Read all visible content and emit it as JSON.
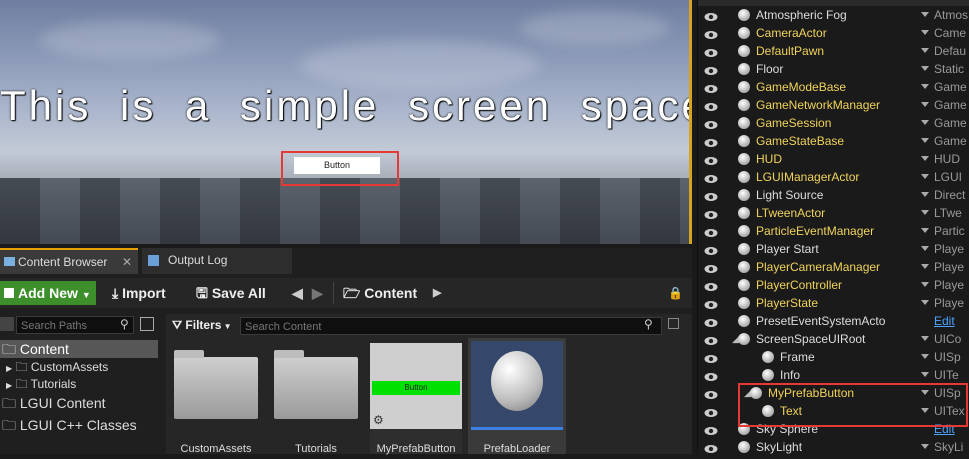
{
  "viewport": {
    "ui_text": "This is a simple screen space UI.",
    "button_label": "Button"
  },
  "tabs": [
    {
      "label": "Content Browser"
    },
    {
      "label": "Output Log"
    }
  ],
  "toolbar": {
    "add_new": "Add New",
    "import": "Import",
    "save_all": "Save All",
    "path": "Content"
  },
  "search": {
    "paths_placeholder": "Search Paths",
    "filters": "Filters",
    "content_placeholder": "Search Content"
  },
  "tree": [
    "Content",
    "CustomAssets",
    "Tutorials",
    "LGUI Content",
    "LGUI C++ Classes"
  ],
  "tiles": [
    {
      "label": "CustomAssets"
    },
    {
      "label": "Tutorials"
    },
    {
      "label": "MyPrefabButton",
      "inner_button": "Button"
    },
    {
      "label": "PrefabLoader"
    }
  ],
  "outliner": {
    "rows": [
      {
        "name": "Atmospheric Fog",
        "type": "Atmos",
        "yellow": false
      },
      {
        "name": "CameraActor",
        "type": "Came",
        "yellow": true
      },
      {
        "name": "DefaultPawn",
        "type": "Defau",
        "yellow": true
      },
      {
        "name": "Floor",
        "type": "Static",
        "yellow": false
      },
      {
        "name": "GameModeBase",
        "type": "Game",
        "yellow": true
      },
      {
        "name": "GameNetworkManager",
        "type": "Game",
        "yellow": true
      },
      {
        "name": "GameSession",
        "type": "Game",
        "yellow": true
      },
      {
        "name": "GameStateBase",
        "type": "Game",
        "yellow": true
      },
      {
        "name": "HUD",
        "type": "HUD",
        "yellow": true
      },
      {
        "name": "LGUIManagerActor",
        "type": "LGUI",
        "yellow": true
      },
      {
        "name": "Light Source",
        "type": "Direct",
        "yellow": false
      },
      {
        "name": "LTweenActor",
        "type": "LTwe",
        "yellow": true
      },
      {
        "name": "ParticleEventManager",
        "type": "Partic",
        "yellow": true
      },
      {
        "name": "Player Start",
        "type": "Playe",
        "yellow": false
      },
      {
        "name": "PlayerCameraManager",
        "type": "Playe",
        "yellow": true
      },
      {
        "name": "PlayerController",
        "type": "Playe",
        "yellow": true
      },
      {
        "name": "PlayerState",
        "type": "Playe",
        "yellow": true
      },
      {
        "name": "PresetEventSystemActo",
        "type": "Edit",
        "yellow": false,
        "link": true
      },
      {
        "name": "ScreenSpaceUIRoot",
        "type": "UICo",
        "yellow": false
      },
      {
        "name": "Frame",
        "type": "UISp",
        "yellow": false
      },
      {
        "name": "Info",
        "type": "UITe",
        "yellow": false
      },
      {
        "name": "MyPrefabButton",
        "type": "UISp",
        "yellow": true
      },
      {
        "name": "Text",
        "type": "UITex",
        "yellow": true
      },
      {
        "name": "Sky Sphere",
        "type": "Edit",
        "yellow": false,
        "link": true
      },
      {
        "name": "SkyLight",
        "type": "SkyLi",
        "yellow": false
      }
    ]
  }
}
